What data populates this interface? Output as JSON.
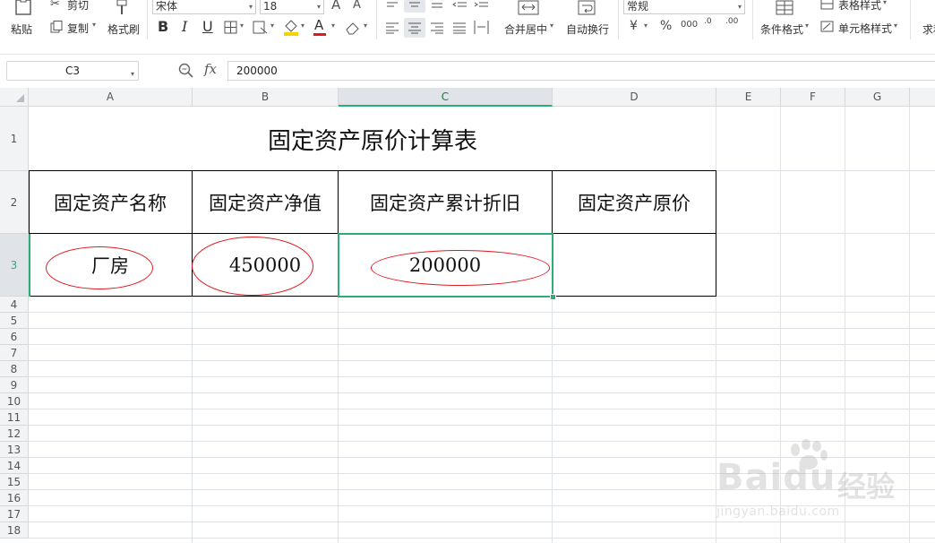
{
  "toolbar": {
    "paste_label": "粘贴",
    "cut_label": "剪切",
    "copy_label": "复制",
    "format_painter_label": "格式刷",
    "font_name": "宋体",
    "font_size": "18",
    "merge_center_label": "合并居中",
    "wrap_text_label": "自动换行",
    "number_format": "常规",
    "conditional_format_label": "条件格式",
    "table_style_label": "表格样式",
    "cell_style_label": "单元格样式",
    "sum_label": "求和",
    "bold_glyph": "B",
    "italic_glyph": "I",
    "underline_glyph": "U",
    "increase_font_glyph": "A",
    "decrease_font_glyph": "A",
    "font_color_glyph": "A",
    "currency_glyph": "¥",
    "percent_glyph": "%",
    "thousands_glyph": "000",
    "inc_decimal_glyph": ".0",
    "dec_decimal_glyph": ".00"
  },
  "formula_bar": {
    "name_box": "C3",
    "fx_label": "fx",
    "content": "200000"
  },
  "sheet": {
    "columns": [
      "A",
      "B",
      "C",
      "D",
      "E",
      "F",
      "G"
    ],
    "active_column": "C",
    "rows": [
      "1",
      "2",
      "3",
      "4",
      "5",
      "6",
      "7",
      "8",
      "9",
      "10",
      "11",
      "12",
      "13",
      "14",
      "15",
      "16",
      "17",
      "18"
    ],
    "active_row": "3",
    "title": "固定资产原价计算表",
    "headers": [
      "固定资产名称",
      "固定资产净值",
      "固定资产累计折旧",
      "固定资产原价"
    ],
    "data_row": [
      "厂房",
      "450000",
      "200000",
      ""
    ]
  },
  "colors": {
    "selection": "#2cae77",
    "annotation_circle": "#e0191f"
  },
  "watermark": {
    "logo": "Bai",
    "logo_tail": "du",
    "brand_cn": "经验",
    "url": "jingyan.baidu.com"
  }
}
